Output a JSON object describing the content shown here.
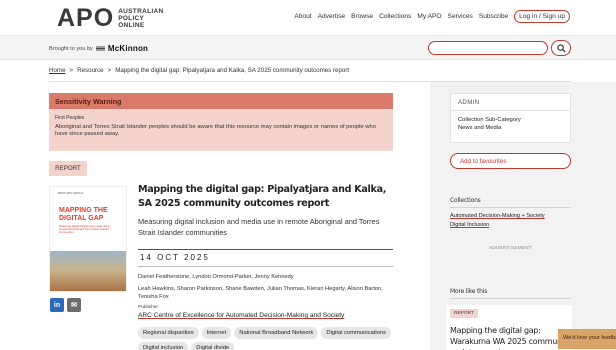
{
  "header": {
    "logo_text": "APO",
    "logo_subtitle": [
      "AUSTRALIAN",
      "POLICY",
      "ONLINE"
    ],
    "nav": [
      "About",
      "Advertise",
      "Browse",
      "Collections",
      "My APO",
      "Services",
      "Subscribe"
    ],
    "login_label": "Log in / Sign up"
  },
  "sponsor": {
    "brought_text": "Brought to you by",
    "sponsor_name": "McKinnon"
  },
  "search": {
    "placeholder": ""
  },
  "breadcrumb": {
    "home": "Home",
    "sep": ">",
    "resource": "Resource",
    "current": "Mapping the digital gap: Pipalyatjara and Kalka, SA 2025 community outcomes report"
  },
  "warning": {
    "title": "Sensitivity Warning",
    "label": "First Peoples",
    "text": "Aboriginal and Torres Strait Islander peoples should be aware that this resource may contain images or names of people who have since passed away."
  },
  "report": {
    "type_tag": "REPORT",
    "cover_title": "MAPPING THE DIGITAL GAP",
    "cover_logos": "RMIT  ARC  ADM+S",
    "title": "Mapping the digital gap: Pipalyatjara and Kalka, SA 2025 community outcomes report",
    "subtitle": "Measuring digital inclusion and media use in remote Aboriginal and Torres Strait Islander communities",
    "date": "14 OCT 2025",
    "authors_line1": "Daniel Featherstone, Lyndon Ormond-Parker, Jenny Kennedy",
    "authors_line2": "Leah Hawkins, Sharon Parkinson, Shane Bawden, Julian Thomas, Kieran Hegarty, Alison Barton, Tenisha Fox",
    "publisher_label": "Publisher",
    "publisher": "ARC Centre of Excellence for Automated Decision-Making and Society",
    "tags": [
      "Regional disparities",
      "Internet",
      "National Broadband Network",
      "Digital communications",
      "Digital inclusion",
      "Digital divide"
    ]
  },
  "share": {
    "linkedin": "in",
    "email": "✉"
  },
  "sidebar": {
    "admin_title": "ADMIN",
    "admin_line1": "Collection Sub-Category",
    "admin_line2": "News and Media",
    "favourite_label": "Add to favourites",
    "collections_title": "Collections",
    "collections": [
      "Automated Decision-Making + Society",
      "Digital Inclusion"
    ],
    "advert_label": "ADVERTISEMENT",
    "more_title": "More like this",
    "more_tag": "REPORT",
    "more_item_title": "Mapping the digital gap: Warakurna WA 2025 community update report"
  },
  "feedback_label": "We'd love your feedback"
}
